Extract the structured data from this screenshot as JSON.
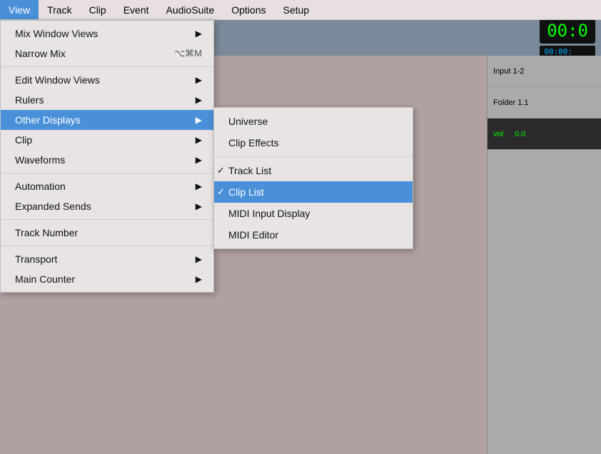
{
  "menubar": {
    "items": [
      {
        "label": "View",
        "active": true
      },
      {
        "label": "Track",
        "active": false
      },
      {
        "label": "Clip",
        "active": false
      },
      {
        "label": "Event",
        "active": false
      },
      {
        "label": "AudioSuite",
        "active": false
      },
      {
        "label": "Options",
        "active": false
      },
      {
        "label": "Setup",
        "active": false
      }
    ]
  },
  "view_menu": {
    "items": [
      {
        "label": "Mix Window Views",
        "hasArrow": true,
        "shortcut": ""
      },
      {
        "label": "Narrow Mix",
        "hasArrow": false,
        "shortcut": "⌥⌘M"
      },
      {
        "separator": true
      },
      {
        "label": "Edit Window Views",
        "hasArrow": true,
        "shortcut": ""
      },
      {
        "label": "Rulers",
        "hasArrow": true,
        "shortcut": ""
      },
      {
        "label": "Other Displays",
        "hasArrow": true,
        "shortcut": "",
        "active": true
      },
      {
        "separator": false
      },
      {
        "label": "Clip",
        "hasArrow": true,
        "shortcut": ""
      },
      {
        "label": "Waveforms",
        "hasArrow": true,
        "shortcut": ""
      },
      {
        "separator": true
      },
      {
        "label": "Automation",
        "hasArrow": true,
        "shortcut": ""
      },
      {
        "label": "Expanded Sends",
        "hasArrow": true,
        "shortcut": ""
      },
      {
        "separator": true
      },
      {
        "label": "Track Number",
        "hasArrow": false,
        "shortcut": ""
      },
      {
        "separator": true
      },
      {
        "label": "Transport",
        "hasArrow": true,
        "shortcut": ""
      },
      {
        "label": "Main Counter",
        "hasArrow": true,
        "shortcut": ""
      }
    ]
  },
  "other_displays_submenu": {
    "items": [
      {
        "label": "Universe",
        "shortcut": "⌥7",
        "checked": false,
        "highlighted": false
      },
      {
        "label": "Clip Effects",
        "shortcut": "⌥6",
        "checked": false,
        "highlighted": false
      },
      {
        "separator": true
      },
      {
        "label": "Track List",
        "shortcut": "",
        "checked": true,
        "highlighted": false
      },
      {
        "label": "Clip List",
        "shortcut": "",
        "checked": true,
        "highlighted": true
      },
      {
        "label": "MIDI Input Display",
        "shortcut": "",
        "checked": false,
        "highlighted": false
      },
      {
        "label": "MIDI Editor",
        "shortcut": "^⌥⇧=",
        "checked": false,
        "highlighted": false
      }
    ]
  },
  "daw": {
    "counter": "00:0",
    "counter_small": "00:00:",
    "input_label": "Input 1-2",
    "folder_label": "Folder 1.1",
    "vol_label": "vol",
    "vol_value": "0.0"
  }
}
